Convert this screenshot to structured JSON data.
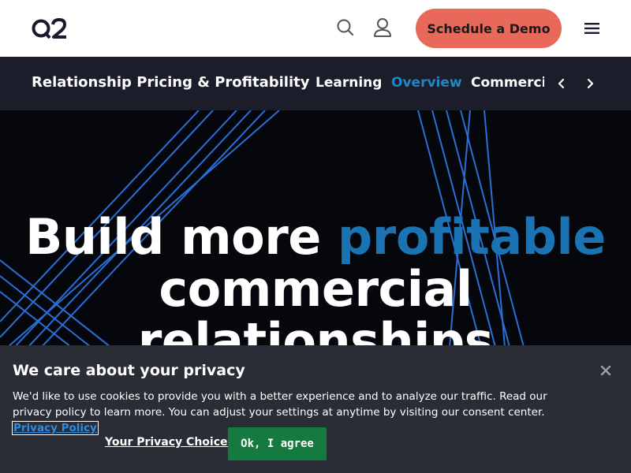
{
  "header": {
    "logo_text": "Q2",
    "search_icon": "search-icon",
    "user_icon": "user-icon",
    "demo_button_label": "Schedule a Demo",
    "menu_icon": "hamburger-menu-icon"
  },
  "subnav": {
    "title": "Relationship Pricing & Profitability",
    "tabs": [
      {
        "label": "Learning",
        "active": false
      },
      {
        "label": "Overview",
        "active": true
      },
      {
        "label": "Commercial",
        "active": false
      }
    ],
    "prev_icon": "chevron-left-icon",
    "next_icon": "chevron-right-icon"
  },
  "hero": {
    "heading_part1": "Build more ",
    "heading_accent": "profitable",
    "heading_part2": "commercial relationships"
  },
  "cookie": {
    "title": "We care about your privacy",
    "body": "We'd like to use cookies to provide you with a better experience and to analyze our traffic. Read our privacy policy to learn more. You can adjust your settings at anytime by visiting our consent center.",
    "privacy_link": "Privacy Policy",
    "choices_label": "Your Privacy Choices",
    "agree_label": "Ok, I agree",
    "close_icon": "close-icon"
  },
  "colors": {
    "brand_coral": "#e8695a",
    "nav_bg": "#1b1e2a",
    "accent_blue": "#1a73b3",
    "cookie_bg": "#2a2d35",
    "agree_green": "#157a3f"
  }
}
